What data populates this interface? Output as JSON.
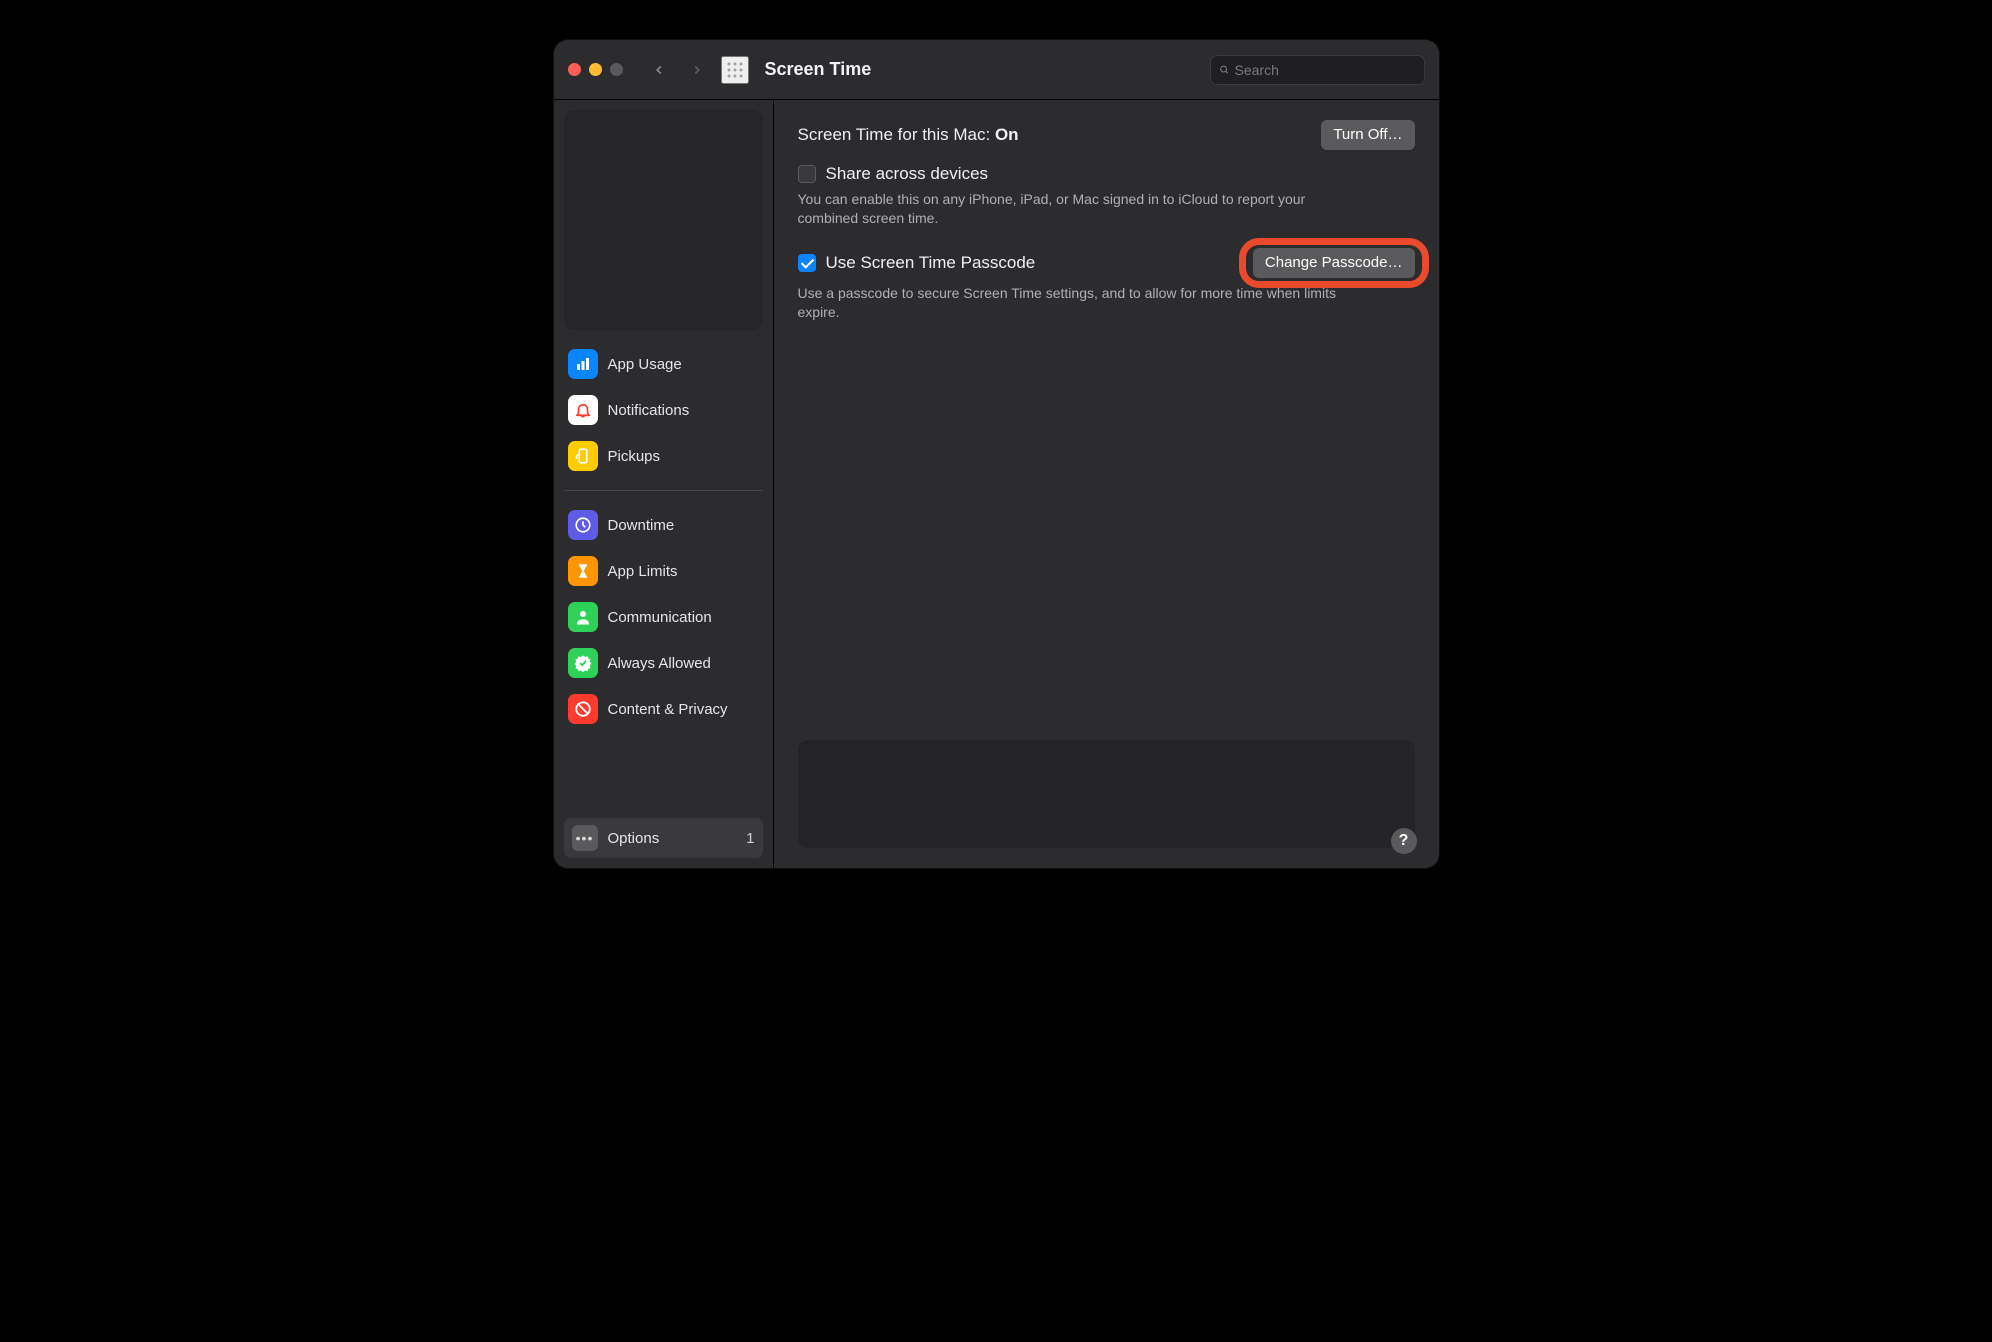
{
  "toolbar": {
    "title": "Screen Time",
    "search_placeholder": "Search"
  },
  "sidebar": {
    "items": [
      {
        "label": "App Usage",
        "icon": "chart-icon",
        "color": "#0a84ff"
      },
      {
        "label": "Notifications",
        "icon": "bell-icon",
        "color": "#ffffff"
      },
      {
        "label": "Pickups",
        "icon": "pickups-icon",
        "color": "#ffcc00"
      },
      {
        "label": "Downtime",
        "icon": "clock-icon",
        "color": "#5e5ce6"
      },
      {
        "label": "App Limits",
        "icon": "hourglass-icon",
        "color": "#ff9500"
      },
      {
        "label": "Communication",
        "icon": "person-icon",
        "color": "#30d158"
      },
      {
        "label": "Always Allowed",
        "icon": "check-icon",
        "color": "#30d158"
      },
      {
        "label": "Content & Privacy",
        "icon": "nosign-icon",
        "color": "#ff3b30"
      }
    ],
    "bottom": {
      "label": "Options",
      "badge": "1"
    }
  },
  "content": {
    "status_prefix": "Screen Time for this Mac: ",
    "status_value": "On",
    "turn_off_label": "Turn Off…",
    "share": {
      "checked": false,
      "label": "Share across devices",
      "desc": "You can enable this on any iPhone, iPad, or Mac signed in to iCloud to report your combined screen time."
    },
    "passcode": {
      "checked": true,
      "label": "Use Screen Time Passcode",
      "button": "Change Passcode…",
      "desc": "Use a passcode to secure Screen Time settings, and to allow for more time when limits expire."
    },
    "help_label": "?"
  },
  "annotations": {
    "highlight_target": "change-passcode-button",
    "highlight_color": "#e94a2b"
  }
}
